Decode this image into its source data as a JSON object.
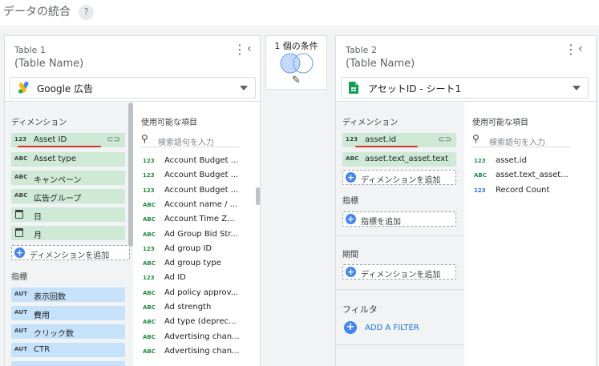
{
  "header": {
    "title": "データの統合",
    "help_icon": "?"
  },
  "join": {
    "label": "1 個の条件",
    "icon": "venn-left-join-icon"
  },
  "table1": {
    "name": "Table 1",
    "subtitle": "(Table Name)",
    "source": "Google 広告",
    "dimensions_label": "ディメンション",
    "dimensions": [
      {
        "type": "123",
        "name": "Asset ID",
        "linked": true
      },
      {
        "type": "ABC",
        "name": "Asset type"
      },
      {
        "type": "ABC",
        "name": "キャンペーン"
      },
      {
        "type": "ABC",
        "name": "広告グループ"
      },
      {
        "type": "cal",
        "name": "日"
      },
      {
        "type": "cal",
        "name": "月"
      }
    ],
    "add_dimension": "ディメンションを追加",
    "metrics_label": "指標",
    "metrics": [
      {
        "type": "AUT",
        "name": "表示回数"
      },
      {
        "type": "AUT",
        "name": "費用"
      },
      {
        "type": "AUT",
        "name": "クリック数"
      },
      {
        "type": "AUT",
        "name": "CTR"
      }
    ],
    "available_label": "使用可能な項目",
    "search_placeholder": "検索語句を入力",
    "available": [
      {
        "type": "123",
        "name": "Account Budget ..."
      },
      {
        "type": "123",
        "name": "Account Budget ..."
      },
      {
        "type": "123",
        "name": "Account Budget ..."
      },
      {
        "type": "ABC",
        "name": "Account name / ..."
      },
      {
        "type": "ABC",
        "name": "Account Time Z..."
      },
      {
        "type": "ABC",
        "name": "Ad Group Bid Str..."
      },
      {
        "type": "123",
        "name": "Ad group ID"
      },
      {
        "type": "ABC",
        "name": "Ad group type"
      },
      {
        "type": "123",
        "name": "Ad ID"
      },
      {
        "type": "ABC",
        "name": "Ad policy approv..."
      },
      {
        "type": "ABC",
        "name": "Ad strength"
      },
      {
        "type": "ABC",
        "name": "Ad type (deprec..."
      },
      {
        "type": "ABC",
        "name": "Advertising chan..."
      },
      {
        "type": "ABC",
        "name": "Advertising chan..."
      }
    ]
  },
  "table2": {
    "name": "Table 2",
    "subtitle": "(Table Name)",
    "source": "アセットID - シート1",
    "dimensions_label": "ディメンション",
    "dimensions": [
      {
        "type": "123",
        "name": "asset.id",
        "linked": true
      },
      {
        "type": "ABC",
        "name": "asset.text_asset.text"
      }
    ],
    "add_dimension": "ディメンションを追加",
    "metrics_label": "指標",
    "add_metric": "指標を追加",
    "period_label": "期間",
    "add_period": "ディメンションを追加",
    "filter_label": "フィルタ",
    "add_filter": "ADD A FILTER",
    "available_label": "使用可能な項目",
    "search_placeholder": "検索語句を入力",
    "available": [
      {
        "type": "123",
        "name": "asset.id"
      },
      {
        "type": "ABC",
        "name": "asset.text_asset..."
      },
      {
        "type": "123",
        "name": "Record Count"
      }
    ]
  },
  "colors": {
    "dimension": "#ceead6",
    "metric": "#c6e2fb",
    "accent": "#4285f4",
    "highlight": "#d93025"
  }
}
